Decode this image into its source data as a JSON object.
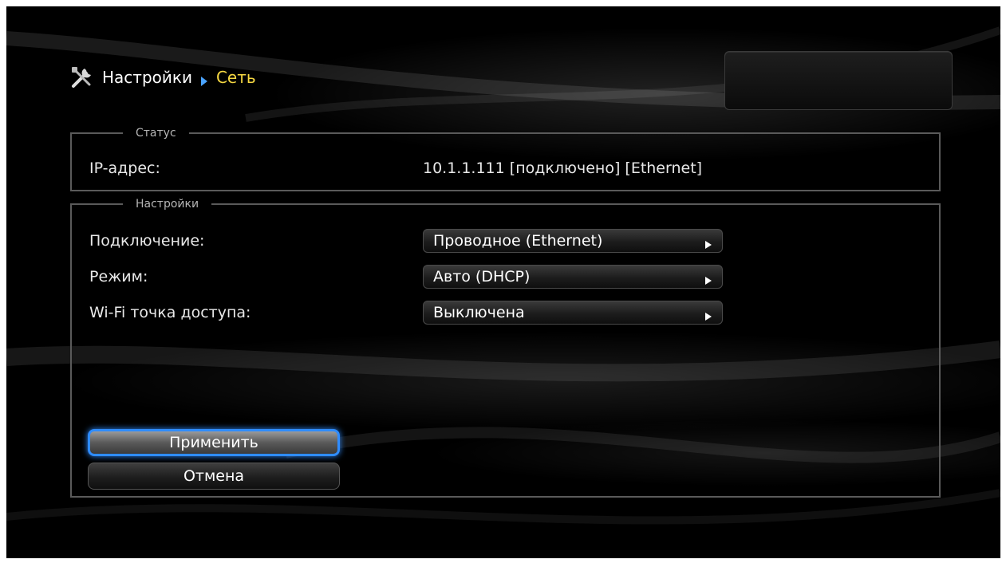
{
  "breadcrumb": {
    "root": "Настройки",
    "current": "Сеть",
    "icon": "tools-icon",
    "separator_icon": "triangle-right-icon"
  },
  "status": {
    "legend": "Статус",
    "ip_label": "IP-адрес:",
    "ip_value": "10.1.1.111 [подключено] [Ethernet]"
  },
  "settings": {
    "legend": "Настройки",
    "rows": [
      {
        "label": "Подключение:",
        "value": "Проводное (Ethernet)"
      },
      {
        "label": "Режим:",
        "value": "Авто (DHCP)"
      },
      {
        "label": "Wi-Fi точка доступа:",
        "value": "Выключена"
      }
    ]
  },
  "buttons": {
    "apply": "Применить",
    "cancel": "Отмена"
  },
  "colors": {
    "accent_focus": "#2f8cff",
    "breadcrumb_active": "#f5d742",
    "background": "#000000"
  }
}
